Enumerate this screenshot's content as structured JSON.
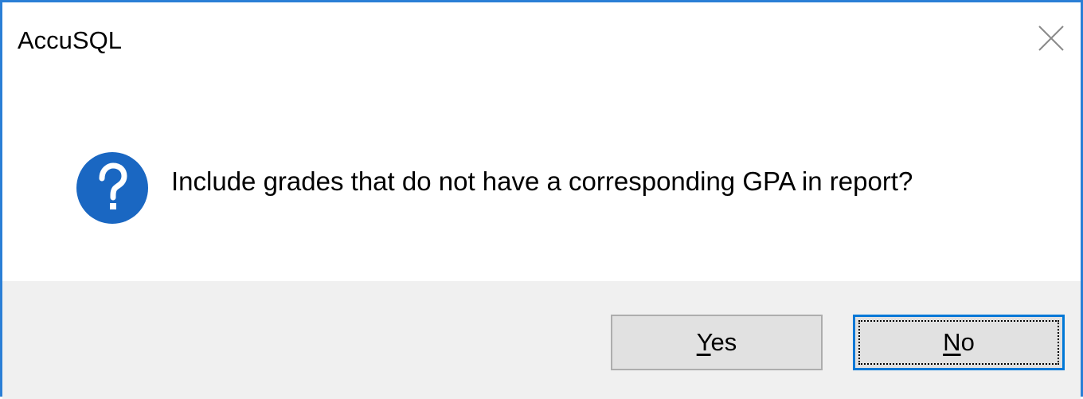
{
  "window": {
    "title": "AccuSQL",
    "close_icon": "close-icon"
  },
  "message": {
    "icon": "question-icon",
    "icon_color": "#1a67c2",
    "text": "Include grades that do not have a corresponding GPA in report?"
  },
  "buttons": {
    "yes": {
      "mnemonic": "Y",
      "rest": "es"
    },
    "no": {
      "mnemonic": "N",
      "rest": "o",
      "focused": true
    }
  },
  "colors": {
    "window_border": "#2b7fd6",
    "footer_bg": "#f0f0f0",
    "button_bg": "#e1e1e1",
    "focused_border": "#0078d7"
  }
}
